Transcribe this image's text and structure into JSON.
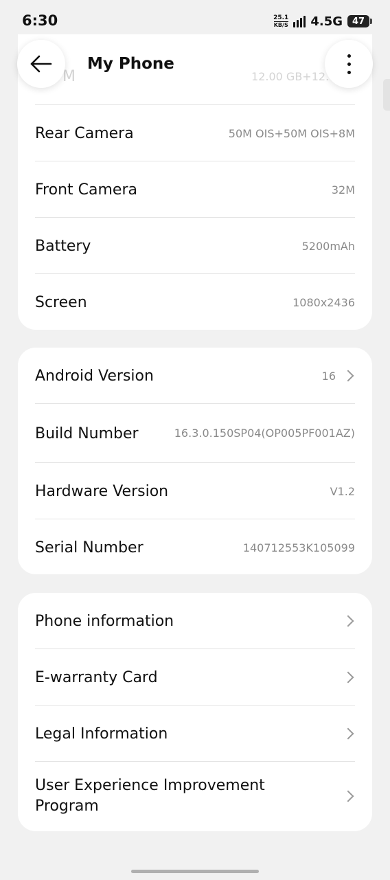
{
  "status_bar": {
    "time": "6:30",
    "net_speed_value": "25.1",
    "net_speed_unit": "KB/S",
    "network_type": "4.5G",
    "battery_level": "47"
  },
  "header": {
    "title": "My Phone"
  },
  "specs": {
    "partial_value": "12.00 GB+12.00 G",
    "partial_label": "M",
    "rows": [
      {
        "label": "Rear Camera",
        "value": "50M OIS+50M OIS+8M"
      },
      {
        "label": "Front Camera",
        "value": "32M"
      },
      {
        "label": "Battery",
        "value": "5200mAh"
      },
      {
        "label": "Screen",
        "value": "1080x2436"
      }
    ]
  },
  "software": {
    "rows": [
      {
        "label": "Android Version",
        "value": "16"
      },
      {
        "label": "Build Number",
        "value": "16.3.0.150SP04(OP005PF001AZ)"
      },
      {
        "label": "Hardware Version",
        "value": "V1.2"
      },
      {
        "label": "Serial Number",
        "value": "140712553K105099"
      }
    ]
  },
  "info": {
    "rows": [
      {
        "label": "Phone information"
      },
      {
        "label": "E-warranty Card"
      },
      {
        "label": "Legal Information"
      },
      {
        "label": "User Experience Improvement Program"
      }
    ]
  }
}
